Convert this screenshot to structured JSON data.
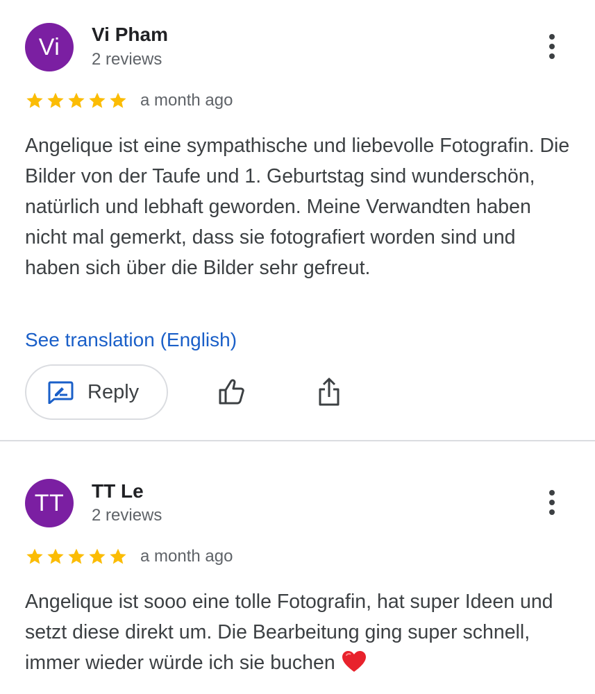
{
  "reviews": [
    {
      "avatar_initials": "Vi",
      "author": "Vi Pham",
      "author_meta": "2 reviews",
      "rating": 5,
      "date": "a month ago",
      "text": "Angelique ist eine sympathische und liebevolle Fotografin. Die Bilder von der Taufe und 1. Geburtstag sind wunderschön, natürlich und lebhaft geworden. Meine Verwandten haben nicht mal gemerkt, dass sie fotografiert worden sind und haben sich über die Bilder sehr gefreut.",
      "translate_link": "See translation (English)",
      "reply_label": "Reply"
    },
    {
      "avatar_initials": "TT",
      "author": "TT Le",
      "author_meta": "2 reviews",
      "rating": 5,
      "date": "a month ago",
      "text": "Angelique ist sooo eine tolle Fotografin, hat super Ideen und setzt diese direkt um. Die Bearbeitung ging super schnell, immer wieder würde ich sie buchen"
    }
  ],
  "colors": {
    "avatar_bg": "#7b1fa2",
    "star": "#fbbc04",
    "link": "#1a5fc8",
    "divider": "#dadce0",
    "heart": "#e8222c"
  },
  "icons": {
    "more": "more-vert-icon",
    "star": "star-icon",
    "reply": "reply-edit-icon",
    "like": "thumbs-up-icon",
    "share": "share-icon",
    "heart": "heart-emoji-icon"
  }
}
